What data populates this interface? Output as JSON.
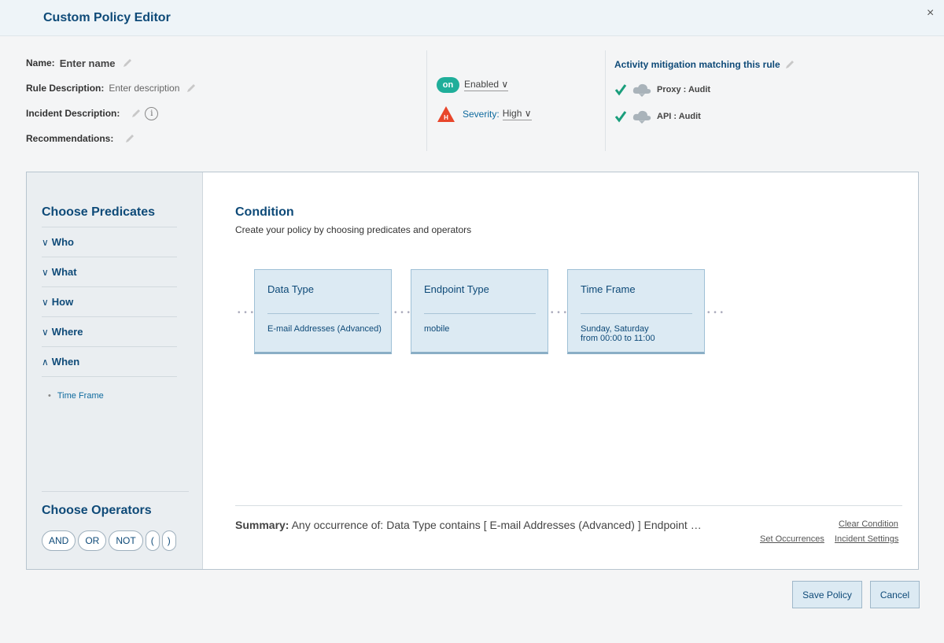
{
  "header": {
    "title": "Custom Policy Editor",
    "close": "×"
  },
  "meta": {
    "name_label": "Name:",
    "name_value": "Enter name",
    "rule_desc_label": "Rule Description:",
    "rule_desc_value": "Enter description",
    "incident_desc_label": "Incident Description:",
    "info_glyph": "i",
    "recommendations_label": "Recommendations:"
  },
  "status": {
    "toggle": "on",
    "enabled": "Enabled",
    "severity_badge": "H",
    "severity_label": "Severity:",
    "severity_value": "High"
  },
  "mitigation": {
    "title": "Activity mitigation matching this rule",
    "items": [
      {
        "label": "Proxy : Audit"
      },
      {
        "label": "API : Audit"
      }
    ]
  },
  "sidebar": {
    "predicates_title": "Choose Predicates",
    "predicates": [
      {
        "label": "Who",
        "chevron": "∨"
      },
      {
        "label": "What",
        "chevron": "∨"
      },
      {
        "label": "How",
        "chevron": "∨"
      },
      {
        "label": "Where",
        "chevron": "∨"
      },
      {
        "label": "When",
        "chevron": "∧"
      }
    ],
    "sub_item": "Time Frame",
    "operators_title": "Choose Operators",
    "operators": [
      "AND",
      "OR",
      "NOT",
      "(",
      ")"
    ]
  },
  "condition": {
    "title": "Condition",
    "subtitle": "Create your policy by choosing predicates and operators",
    "connector": "• • •",
    "cards": [
      {
        "title": "Data Type",
        "value": "E-mail Addresses (Advanced)"
      },
      {
        "title": "Endpoint Type",
        "value": "mobile"
      },
      {
        "title": "Time Frame",
        "value": "Sunday, Saturday\nfrom 00:00 to 11:00"
      }
    ]
  },
  "summary": {
    "label": "Summary:",
    "text": "Any occurrence of: Data Type contains [ E-mail Addresses (Advanced) ] Endpoint …",
    "clear": "Clear Condition",
    "set_occurrences": "Set Occurrences",
    "incident_settings": "Incident Settings"
  },
  "buttons": {
    "save": "Save Policy",
    "cancel": "Cancel"
  },
  "colors": {
    "brand": "#0e4a78",
    "toggle_on": "#1fae9a",
    "severity_high": "#e8462b",
    "check": "#1a9e7c",
    "card_bg": "#dceaf3"
  }
}
